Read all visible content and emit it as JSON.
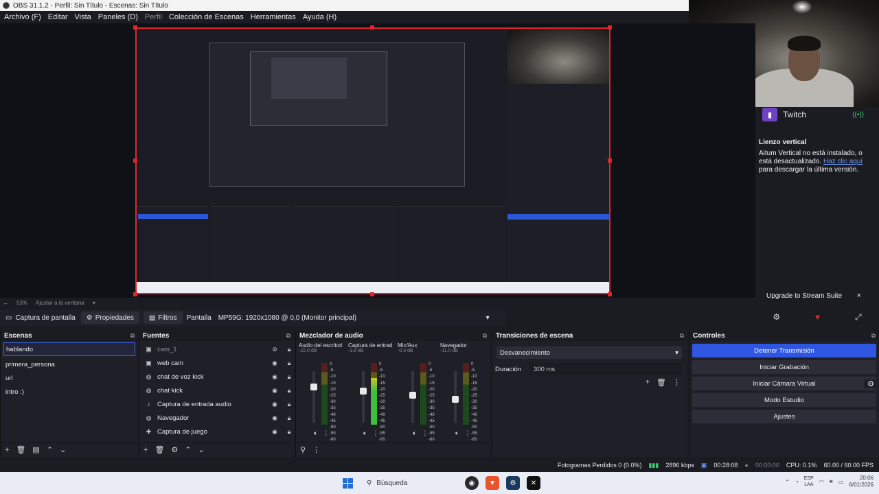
{
  "window": {
    "title": "OBS 31.1.2 - Perfil: Sin Título - Escenas: Sin Título"
  },
  "menu": [
    "Archivo (F)",
    "Editar",
    "Vista",
    "Paneles (D)",
    "Perfil",
    "Colección de Escenas",
    "Herramientas",
    "Ayuda (H)"
  ],
  "preview": {
    "zoom": "53%",
    "fit_label": "Ajustar a la ventana"
  },
  "dock_side": {
    "service": "Twitch",
    "vertical_title": "Lienzo vertical",
    "vertical_msg": "Aitum Vertical no está instalado, o está desactualizado.",
    "vertical_link": "Haz clic aquí",
    "vertical_msg2": "para descargar la última versión.",
    "upgrade_label": "Upgrade to Stream Suite",
    "close_icon": "×"
  },
  "source_bar": {
    "name": "Captura de pantalla",
    "props": "Propiedades",
    "filters": "Filtros",
    "display_label": "Pantalla",
    "display_value": "MP59G: 1920x1080 @ 0,0 (Monitor principal)"
  },
  "scenes": {
    "title": "Escenas",
    "items": [
      "hablando",
      "primera_persona",
      "url",
      "intro :)"
    ]
  },
  "sources": {
    "title": "Fuentes",
    "items": [
      {
        "name": "cam_1",
        "icon": "camera-icon"
      },
      {
        "name": "web cam",
        "icon": "camera-icon"
      },
      {
        "name": "chat de voz kick",
        "icon": "globe-icon"
      },
      {
        "name": "chat kick",
        "icon": "globe-icon"
      },
      {
        "name": "Captura de entrada audio",
        "icon": "mic-icon"
      },
      {
        "name": "Navegador",
        "icon": "globe-icon"
      },
      {
        "name": "Captura de juego",
        "icon": "gamepad-icon"
      }
    ]
  },
  "mixer": {
    "title": "Mezclador de audio",
    "channels": [
      {
        "name": "Audio del escritorio",
        "db": "-22.0 dB",
        "level": 0.0
      },
      {
        "name": "Captura de entrada",
        "db": "-3.8 dB",
        "level": 0.75
      },
      {
        "name": "Mic/Aux",
        "db": "-0.3 dB",
        "level": 0.0
      },
      {
        "name": "Navegador",
        "db": "-11.0 dB",
        "level": 0.0
      }
    ],
    "scale": [
      "0",
      "-5",
      "-10",
      "-15",
      "-20",
      "-25",
      "-30",
      "-35",
      "-40",
      "-45",
      "-50",
      "-55",
      "-60"
    ]
  },
  "transitions": {
    "title": "Transiciones de escena",
    "selected": "Desvanecimiento",
    "duration_label": "Duración",
    "duration_value": "300 ms"
  },
  "controls": {
    "title": "Controles",
    "buttons": [
      "Detener Transmisión",
      "Iniciar Grabación",
      "Iniciar Cámara Virtual",
      "Modo Estudio",
      "Ajustes"
    ]
  },
  "status": {
    "dropped": "Fotogramas Perdidos 0 (0.0%)",
    "bitrate": "2896 kbps",
    "stream_time": "00:28:08",
    "rec_time": "00:00:00",
    "cpu": "CPU: 0.1%",
    "fps": "60.00 / 60.00 FPS"
  },
  "taskbar": {
    "search": "Búsqueda",
    "lang1": "ESP",
    "lang2": "LAA",
    "time": "20:06",
    "date": "8/01/2026"
  },
  "colors": {
    "accent": "#2f56e0",
    "selection": "#e0252c",
    "live": "#3ccf71"
  }
}
